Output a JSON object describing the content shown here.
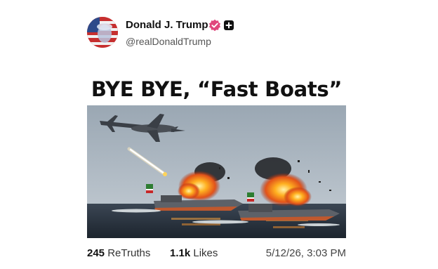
{
  "post": {
    "author": {
      "name": "Donald J. Trump",
      "handle": "@realDonaldTrump",
      "verified_icon": "verified-badge-icon",
      "plus_icon": "plus-square-icon"
    },
    "headline": "BYE BYE, “Fast Boats”",
    "stats": {
      "retruths_count": "245",
      "retruths_label": "ReTruths",
      "likes_count": "1.1k",
      "likes_label": "Likes",
      "timestamp": "5/12/26, 3:03 PM"
    }
  },
  "colors": {
    "verified_badge": "#e0457b",
    "text_primary": "#111111",
    "text_secondary": "#555555"
  }
}
